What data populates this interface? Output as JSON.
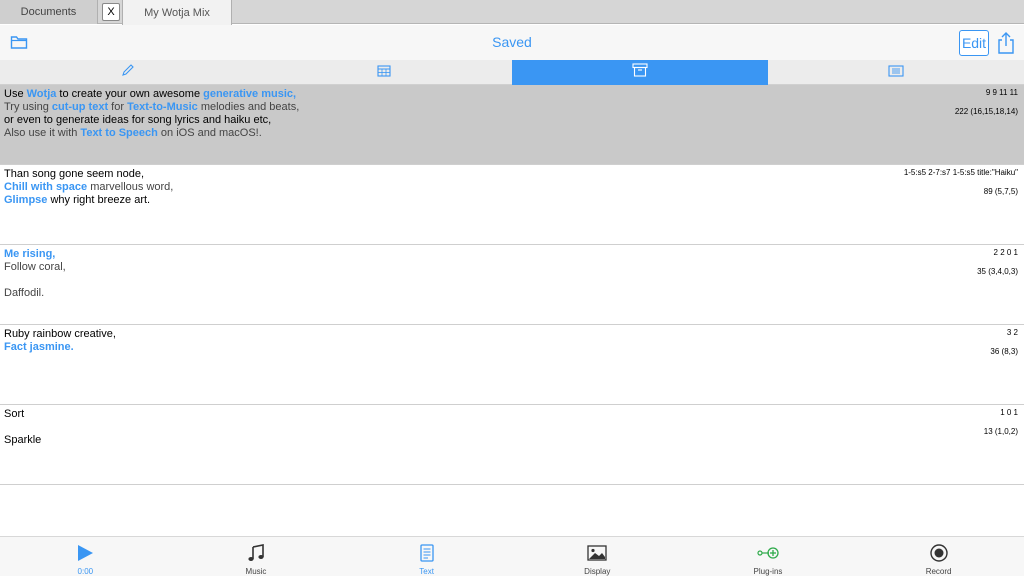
{
  "tabs": {
    "documents": "Documents",
    "close": "X",
    "active": "My Wotja Mix"
  },
  "nav": {
    "title": "Saved",
    "edit": "Edit",
    "icons": [
      "folder-icon",
      "share-icon"
    ]
  },
  "segments": [
    {
      "icon": "pencil-icon",
      "active": false
    },
    {
      "icon": "calendar-grid-icon",
      "active": false
    },
    {
      "icon": "archive-box-icon",
      "active": true
    },
    {
      "icon": "list-lines-icon",
      "active": false
    }
  ],
  "rows": [
    {
      "lines": [
        [
          {
            "t": "Use ",
            "s": "dark"
          },
          {
            "t": "Wotja",
            "s": "blue"
          },
          {
            "t": " to create your own awesome ",
            "s": "dark"
          },
          {
            "t": "generative music,",
            "s": "blue"
          }
        ],
        [
          {
            "t": "Try using ",
            "s": "muted"
          },
          {
            "t": "cut-up text",
            "s": "blue"
          },
          {
            "t": " for ",
            "s": "muted"
          },
          {
            "t": "Text-to-Music",
            "s": "blue"
          },
          {
            "t": " melodies and beats,",
            "s": "muted"
          }
        ],
        [
          {
            "t": "or even to generate ideas for song lyrics and haiku etc,",
            "s": "dark"
          }
        ],
        [
          {
            "t": "Also use it with ",
            "s": "muted"
          },
          {
            "t": "Text to Speech",
            "s": "blue"
          },
          {
            "t": " on iOS and macOS!.",
            "s": "muted"
          }
        ]
      ],
      "meta1": "9 9 11 11",
      "meta2": "222 (16,15,18,14)",
      "highlight": true
    },
    {
      "lines": [
        [
          {
            "t": "Than song gone seem node,",
            "s": "dark"
          }
        ],
        [
          {
            "t": "Chill with space",
            "s": "blue"
          },
          {
            "t": " marvellous word,",
            "s": "muted"
          }
        ],
        [
          {
            "t": "Glimpse",
            "s": "blue"
          },
          {
            "t": " why right breeze art.",
            "s": "dark"
          }
        ]
      ],
      "meta1": "1-5:s5 2-7:s7 1-5:s5 title:\"Haiku\"",
      "meta2": "89 (5,7,5)",
      "highlight": false
    },
    {
      "lines": [
        [
          {
            "t": "Me rising,",
            "s": "blue"
          }
        ],
        [
          {
            "t": "Follow coral,",
            "s": "muted"
          }
        ],
        [],
        [
          {
            "t": "Daffodil.",
            "s": "muted"
          }
        ]
      ],
      "meta1": "2 2 0 1",
      "meta2": "35 (3,4,0,3)",
      "highlight": false
    },
    {
      "lines": [
        [
          {
            "t": "Ruby rainbow creative,",
            "s": "dark"
          }
        ],
        [
          {
            "t": "Fact jasmine.",
            "s": "blue"
          }
        ]
      ],
      "meta1": "3 2",
      "meta2": "36 (8,3)",
      "highlight": false
    },
    {
      "lines": [
        [
          {
            "t": "Sort",
            "s": "dark"
          }
        ],
        [],
        [
          {
            "t": "Sparkle",
            "s": "dark"
          }
        ]
      ],
      "meta1": "1 0 1",
      "meta2": "13 (1,0,2)",
      "highlight": false
    }
  ],
  "tabbar": [
    {
      "label": "0:00",
      "icon": "play-icon",
      "color": "#3a96f3"
    },
    {
      "label": "Music",
      "icon": "music-note-icon",
      "color": "#444444"
    },
    {
      "label": "Text",
      "icon": "text-document-icon",
      "color": "#3a96f3"
    },
    {
      "label": "Display",
      "icon": "image-icon",
      "color": "#444444"
    },
    {
      "label": "Plug-ins",
      "icon": "plug-in-icon",
      "color": "#2eaa4a"
    },
    {
      "label": "Record",
      "icon": "record-icon",
      "color": "#444444"
    }
  ],
  "colors": {
    "accent": "#3a96f3",
    "highlight_row": "#c9c9c9",
    "plugin_green": "#2eaa4a"
  }
}
